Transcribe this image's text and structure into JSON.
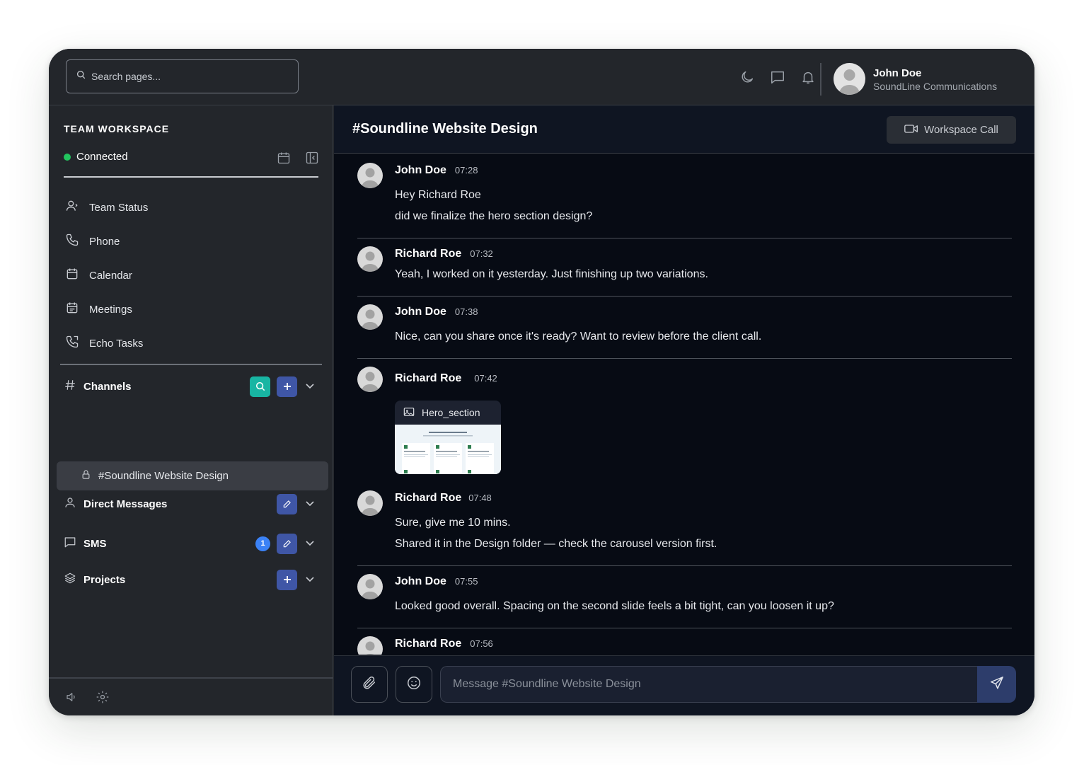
{
  "search": {
    "placeholder": "Search pages..."
  },
  "user": {
    "name": "John Doe",
    "org": "SoundLine Communications"
  },
  "top_icons": [
    "moon-icon",
    "message-icon",
    "bell-icon"
  ],
  "sidebar": {
    "title": "TEAM WORKSPACE",
    "status": "Connected",
    "status_color": "#22c55e",
    "nav": [
      {
        "label": "Team Status",
        "icon": "team-status-icon"
      },
      {
        "label": "Phone",
        "icon": "phone-icon"
      },
      {
        "label": "Calendar",
        "icon": "calendar-icon"
      },
      {
        "label": "Meetings",
        "icon": "meetings-icon"
      },
      {
        "label": "Echo Tasks",
        "icon": "echo-tasks-icon"
      }
    ],
    "channels": {
      "label": "Channels",
      "active": "#Soundline Website Design"
    },
    "direct_messages": {
      "label": "Direct Messages"
    },
    "sms": {
      "label": "SMS",
      "badge": "1"
    },
    "projects": {
      "label": "Projects"
    }
  },
  "channel": {
    "title": "#Soundline Website Design",
    "call_label": "Workspace Call"
  },
  "messages": [
    {
      "name": "John Doe",
      "time": "07:28",
      "lines": [
        "Hey Richard Roe",
        "did we finalize the hero section design?"
      ]
    },
    {
      "name": "Richard Roe",
      "time": "07:32",
      "lines": [
        "Yeah, I worked on it yesterday. Just finishing up two variations."
      ]
    },
    {
      "name": "John Doe",
      "time": "07:38",
      "lines": [
        "Nice, can you share once it's ready? Want to review before the client call."
      ]
    },
    {
      "name": "Richard Roe",
      "time": "07:42",
      "attachment": "Hero_section"
    },
    {
      "name": "Richard Roe",
      "time": "07:48",
      "lines": [
        "Sure, give me 10 mins.",
        "Shared it in the Design folder — check the carousel version first."
      ]
    },
    {
      "name": "John Doe",
      "time": "07:55",
      "lines": [
        "Looked good overall. Spacing on the second slide feels a bit tight, can you loosen it up?"
      ]
    },
    {
      "name": "Richard Roe",
      "time": "07:56",
      "lines": []
    }
  ],
  "composer": {
    "placeholder": "Message #Soundline Website Design"
  },
  "colors": {
    "accent_blue": "#3f56a6",
    "accent_teal": "#18b5a3",
    "badge_blue": "#3b82f6"
  }
}
